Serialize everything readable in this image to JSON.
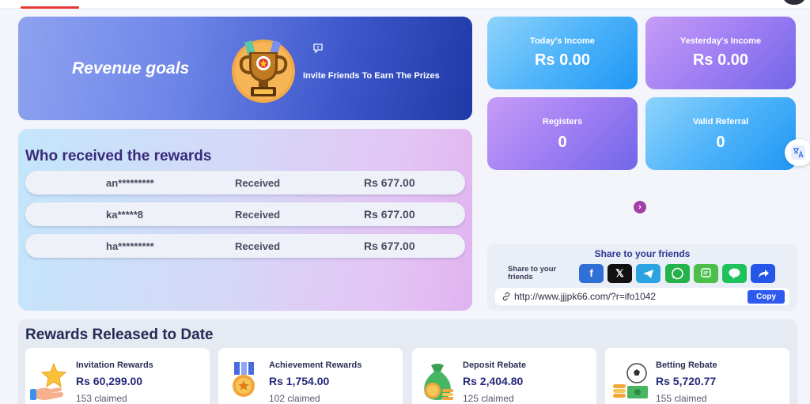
{
  "revenue": {
    "title": "Revenue goals",
    "invite_text": "Invite Friends To Earn The Prizes"
  },
  "stats": [
    {
      "label": "Today's Income",
      "value": "Rs  0.00"
    },
    {
      "label": "Yesterday's Income",
      "value": "Rs  0.00"
    },
    {
      "label": "Registers",
      "value": "0"
    },
    {
      "label": "Valid Referral",
      "value": "0"
    }
  ],
  "who": {
    "title": "Who received the rewards",
    "rows": [
      {
        "name": "an*********",
        "status": "Received",
        "amount": "Rs  677.00"
      },
      {
        "name": "ka*****8",
        "status": "Received",
        "amount": "Rs  677.00"
      },
      {
        "name": "ha*********",
        "status": "Received",
        "amount": "Rs  677.00"
      }
    ]
  },
  "share": {
    "title": "Share to your friends",
    "subtitle": "Share to your friends",
    "link": "http://www.jjjpk66.com/?r=ifo1042",
    "copy_label": "Copy",
    "icons": [
      "facebook-icon",
      "x-icon",
      "telegram-icon",
      "whatsapp-icon",
      "sms-icon",
      "line-icon",
      "share-icon"
    ]
  },
  "rewards": {
    "title": "Rewards Released to Date",
    "items": [
      {
        "name": "Invitation Rewards",
        "amount": "Rs  60,299.00",
        "claimed": "153 claimed"
      },
      {
        "name": "Achievement Rewards",
        "amount": "Rs  1,754.00",
        "claimed": "102 claimed"
      },
      {
        "name": "Deposit Rebate",
        "amount": "Rs  2,404.80",
        "claimed": "125 claimed"
      },
      {
        "name": "Betting Rebate",
        "amount": "Rs  5,720.77",
        "claimed": "155 claimed"
      }
    ]
  },
  "colors": {
    "accent_blue": "#1f96f4",
    "accent_purple": "#7166e8",
    "title_navy": "#262b55",
    "top_red": "#e53935"
  }
}
